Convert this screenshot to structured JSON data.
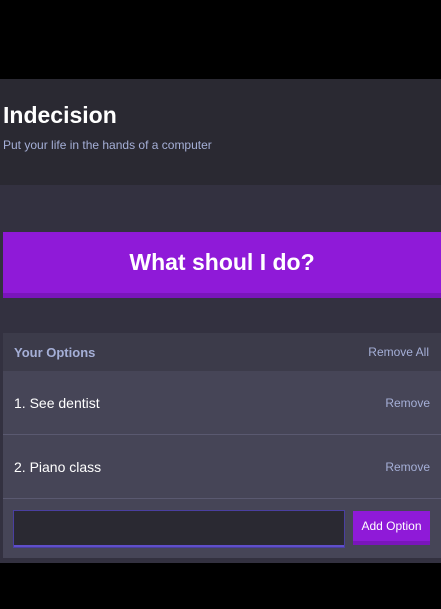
{
  "header": {
    "title": "Indecision",
    "subtitle": "Put your life in the hands of a computer"
  },
  "action": {
    "label": "What shoul I do?"
  },
  "options": {
    "title": "Your Options",
    "remove_all_label": "Remove All",
    "items": [
      {
        "text": "1. See dentist",
        "remove_label": "Remove"
      },
      {
        "text": "2. Piano class",
        "remove_label": "Remove"
      }
    ]
  },
  "add_option": {
    "value": "",
    "placeholder": "",
    "button_label": "Add Option"
  },
  "colors": {
    "accent": "#8f1ad8",
    "header_bg": "#2a2932",
    "page_bg": "#333140",
    "widget_bg": "#464557",
    "muted_text": "#a5afd7"
  }
}
